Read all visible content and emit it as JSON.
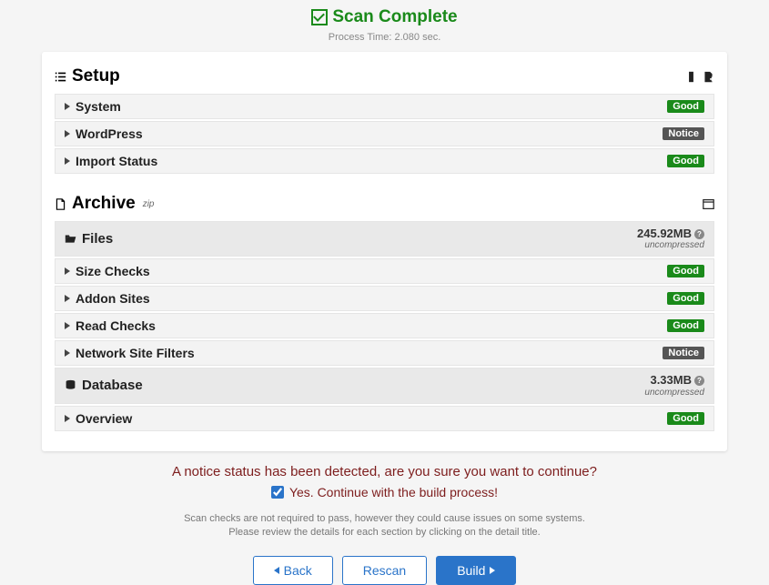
{
  "header": {
    "title": "Scan Complete",
    "process_time": "Process Time: 2.080 sec."
  },
  "setup": {
    "title": "Setup",
    "rows": [
      {
        "label": "System",
        "status": "Good",
        "status_class": "good"
      },
      {
        "label": "WordPress",
        "status": "Notice",
        "status_class": "notice"
      },
      {
        "label": "Import Status",
        "status": "Good",
        "status_class": "good"
      }
    ]
  },
  "archive": {
    "title": "Archive",
    "suffix": "zip",
    "files": {
      "label": "Files",
      "size": "245.92MB",
      "sub": "uncompressed",
      "rows": [
        {
          "label": "Size Checks",
          "status": "Good",
          "status_class": "good"
        },
        {
          "label": "Addon Sites",
          "status": "Good",
          "status_class": "good"
        },
        {
          "label": "Read Checks",
          "status": "Good",
          "status_class": "good"
        },
        {
          "label": "Network Site Filters",
          "status": "Notice",
          "status_class": "notice"
        }
      ]
    },
    "database": {
      "label": "Database",
      "size": "3.33MB",
      "sub": "uncompressed",
      "rows": [
        {
          "label": "Overview",
          "status": "Good",
          "status_class": "good"
        }
      ]
    }
  },
  "footer": {
    "notice": "A notice status has been detected, are you sure you want to continue?",
    "continue_label": "Yes. Continue with the build process!",
    "help1": "Scan checks are not required to pass, however they could cause issues on some systems.",
    "help2": "Please review the details for each section by clicking on the detail title.",
    "back": "Back",
    "rescan": "Rescan",
    "build": "Build"
  }
}
